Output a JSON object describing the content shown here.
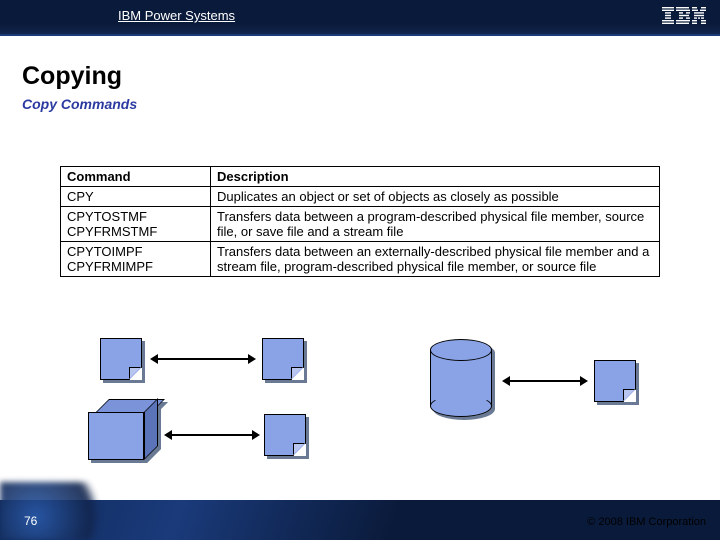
{
  "header": {
    "title": "IBM Power Systems",
    "logo_text": "IBM"
  },
  "headings": {
    "h1": "Copying",
    "h2": "Copy Commands"
  },
  "table": {
    "headers": {
      "col1": "Command",
      "col2": "Description"
    },
    "rows": [
      {
        "cmd": "CPY",
        "desc": "Duplicates an object or set of objects as closely as possible"
      },
      {
        "cmd": "CPYTOSTMF\nCPYFRMSTMF",
        "desc": "Transfers data between a program-described physical file member, source file, or save file and a stream file"
      },
      {
        "cmd": "CPYTOIMPF\nCPYFRMIMPF",
        "desc": "Transfers data between an externally-described physical file member and a stream file, program-described physical file member, or source file"
      }
    ]
  },
  "footer": {
    "page": "76",
    "copyright": "© 2008 IBM Corporation"
  }
}
